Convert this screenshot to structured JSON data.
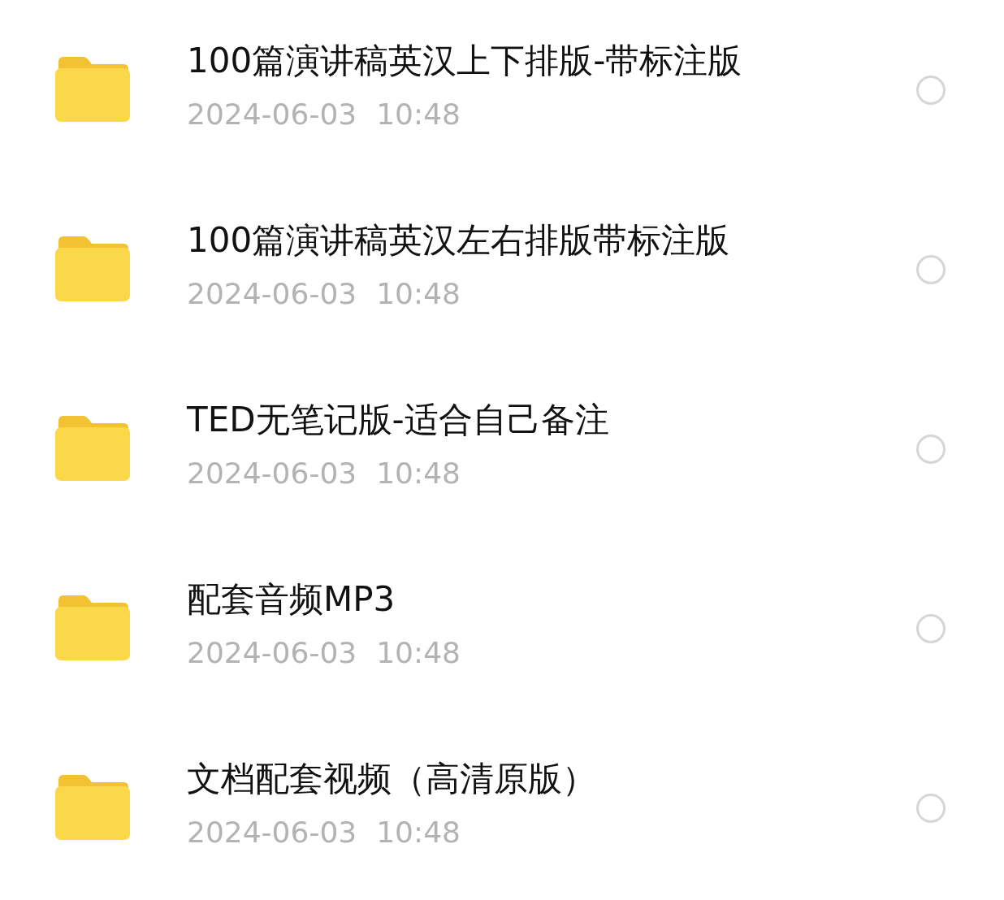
{
  "files": [
    {
      "name": "100篇演讲稿英汉上下排版-带标注版",
      "date": "2024-06-03",
      "time": "10:48",
      "selected": false
    },
    {
      "name": "100篇演讲稿英汉左右排版带标注版",
      "date": "2024-06-03",
      "time": "10:48",
      "selected": false
    },
    {
      "name": "TED无笔记版-适合自己备注",
      "date": "2024-06-03",
      "time": "10:48",
      "selected": false
    },
    {
      "name": "配套音频MP3",
      "date": "2024-06-03",
      "time": "10:48",
      "selected": false
    },
    {
      "name": "文档配套视频（高清原版）",
      "date": "2024-06-03",
      "time": "10:48",
      "selected": false
    }
  ]
}
